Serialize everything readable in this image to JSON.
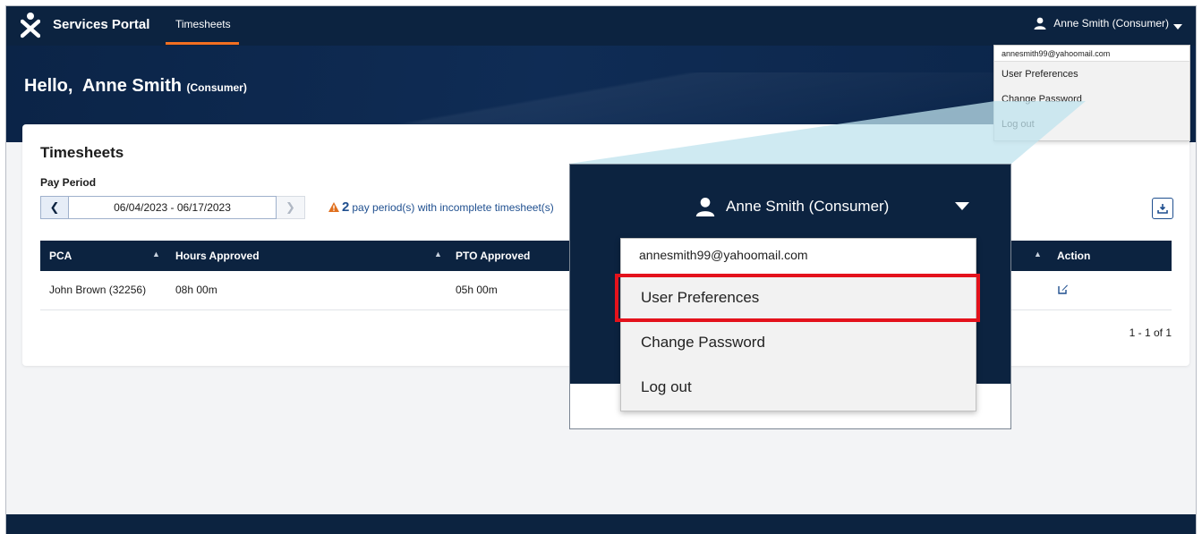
{
  "nav": {
    "brand": "Services Portal",
    "tab": "Timesheets",
    "user": "Anne Smith (Consumer)"
  },
  "hero": {
    "greeting": "Hello,",
    "name": "Anne Smith",
    "role": "(Consumer)"
  },
  "card": {
    "title": "Timesheets",
    "pay_period_label": "Pay Period",
    "pay_period_range": "06/04/2023 - 06/17/2023",
    "warning_count": "2",
    "warning_text": "pay period(s) with incomplete timesheet(s)",
    "pager": "1 - 1 of 1"
  },
  "table": {
    "headers": {
      "pca": "PCA",
      "hours": "Hours Approved",
      "pto": "PTO Approved",
      "action": "Action"
    },
    "rows": [
      {
        "pca": "John Brown (32256)",
        "hours": "08h 00m",
        "pto": "05h 00m"
      }
    ]
  },
  "dropdown": {
    "email": "annesmith99@yahoomail.com",
    "items": [
      "User Preferences",
      "Change Password",
      "Log out"
    ]
  },
  "colors": {
    "navy": "#0c2340",
    "accent": "#f36f21",
    "highlight": "#e4121c",
    "warning": "#e0701f"
  }
}
